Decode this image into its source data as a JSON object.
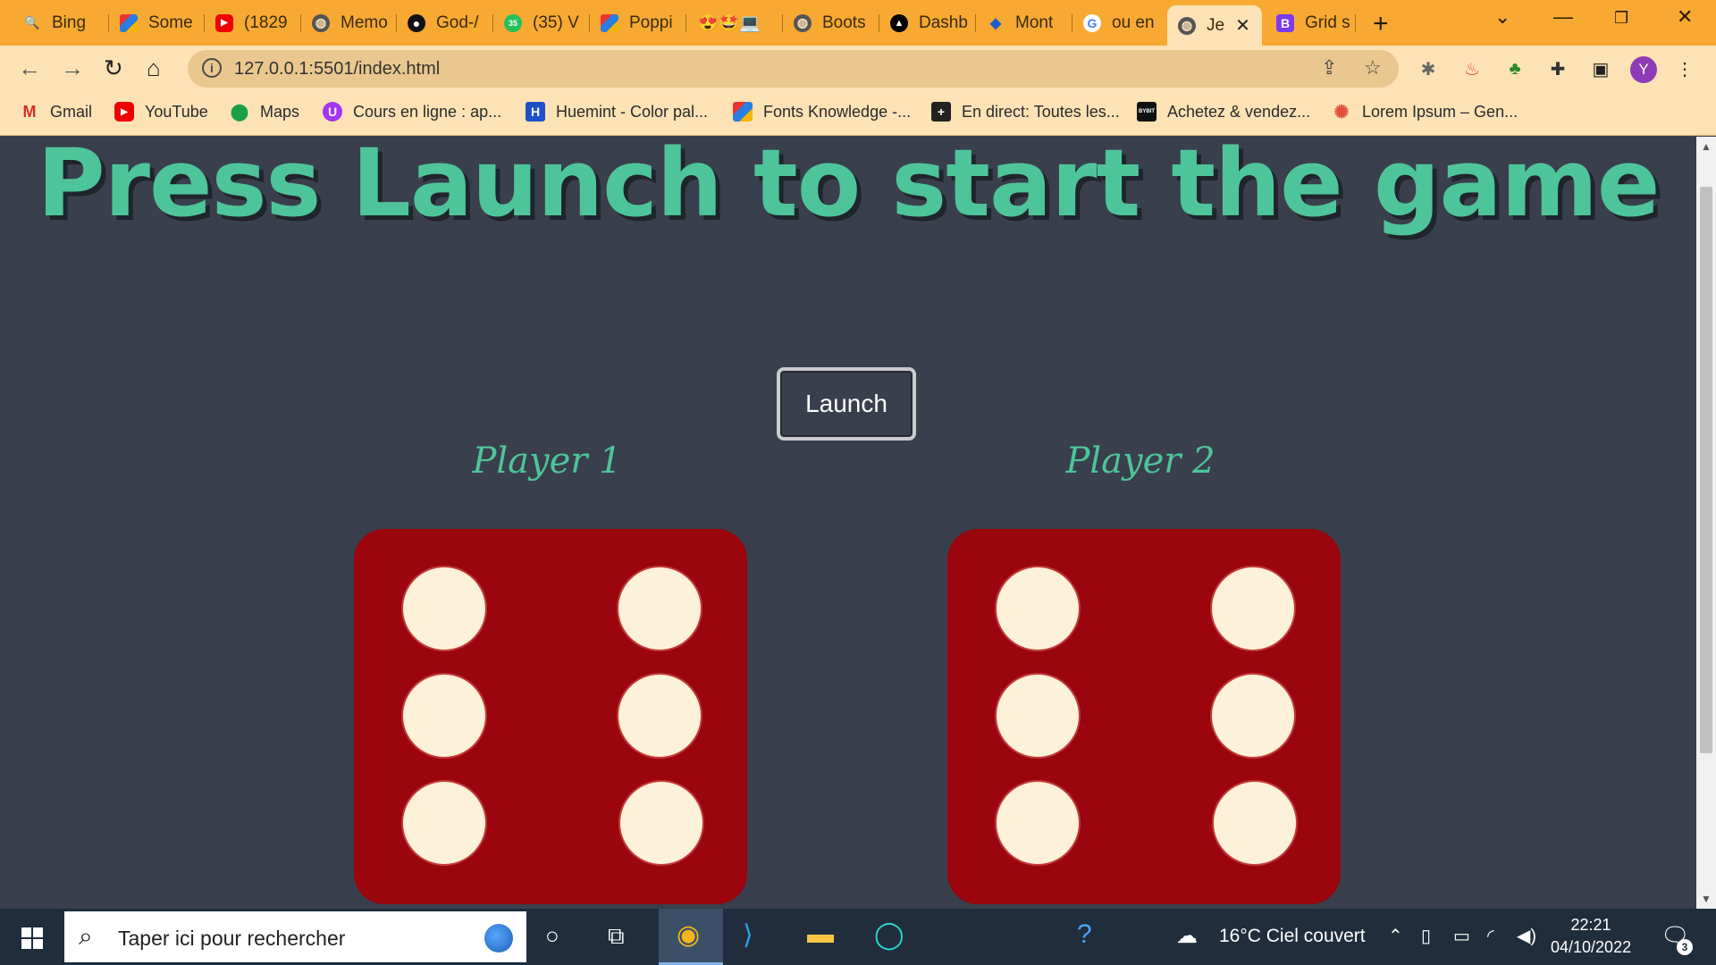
{
  "browser": {
    "tabs": [
      {
        "label": "Bing",
        "icon": "bing-icon"
      },
      {
        "label": "Some",
        "icon": "colorful-icon"
      },
      {
        "label": "(1829",
        "icon": "youtube-icon"
      },
      {
        "label": "Memo",
        "icon": "globe-icon"
      },
      {
        "label": "God-/",
        "icon": "github-icon"
      },
      {
        "label": "(35) V",
        "icon": "whatsapp-icon"
      },
      {
        "label": "Poppi",
        "icon": "colorful-icon"
      },
      {
        "label": "😍🤩💻",
        "icon": "emoji-icon"
      },
      {
        "label": "Boots",
        "icon": "globe-icon"
      },
      {
        "label": "Dashb",
        "icon": "vercel-icon"
      },
      {
        "label": "Mont",
        "icon": "carrefour-icon"
      },
      {
        "label": "ou en",
        "icon": "google-icon"
      },
      {
        "label": "Je",
        "icon": "globe-icon"
      },
      {
        "label": "Grid s",
        "icon": "bootstrap-icon"
      }
    ],
    "url": "127.0.0.1:5501/index.html",
    "profile_initial": "Y",
    "bookmarks": [
      {
        "label": "Gmail",
        "icon": "gmail-icon"
      },
      {
        "label": "YouTube",
        "icon": "youtube-icon"
      },
      {
        "label": "Maps",
        "icon": "maps-icon"
      },
      {
        "label": "Cours en ligne  : ap...",
        "icon": "udemy-icon"
      },
      {
        "label": "Huemint - Color pal...",
        "icon": "huemint-icon"
      },
      {
        "label": "Fonts Knowledge -...",
        "icon": "colorful-icon"
      },
      {
        "label": "En direct: Toutes les...",
        "icon": "plus-icon"
      },
      {
        "label": "Achetez & vendez...",
        "icon": "bybit-icon"
      },
      {
        "label": "Lorem Ipsum – Gen...",
        "icon": "lorem-icon"
      }
    ]
  },
  "game": {
    "headline": "Press Launch to start the game",
    "launch_label": "Launch",
    "player1_label": "Player 1",
    "player2_label": "Player 2",
    "player1_die_value": 6,
    "player2_die_value": 6,
    "die_color": "#9a050e",
    "pip_color": "#fdf1d9",
    "accent_color": "#4ec49a"
  },
  "taskbar": {
    "search_placeholder": "Taper ici pour rechercher",
    "weather": "16°C  Ciel couvert",
    "time": "22:21",
    "date": "04/10/2022",
    "notification_count": "3"
  }
}
